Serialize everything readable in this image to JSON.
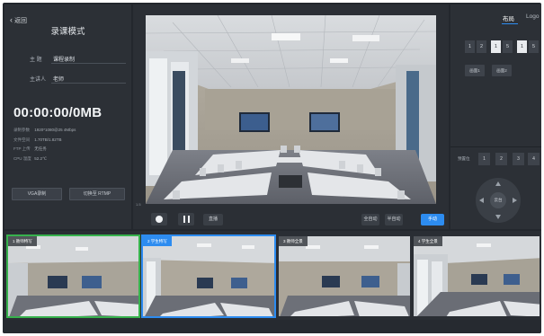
{
  "left": {
    "back": "返回",
    "title": "录课模式",
    "subject_label": "主 题",
    "subject_value": "课程录制",
    "speaker_label": "主讲人",
    "speaker_value": "老师",
    "timer": "00:00:00/0MB",
    "stats": [
      {
        "key": "录制参数",
        "value": "1920*1080@25 4Mbps"
      },
      {
        "key": "文件空间",
        "value": "1.70TB/1.82TB"
      },
      {
        "key": "FTP 上传",
        "value": "无任务"
      },
      {
        "key": "CPU 温度",
        "value": "52.2℃"
      }
    ],
    "vga_button": "VGA录制",
    "rtmp_button": "切换至 RTMP"
  },
  "center": {
    "corner_label": "1.5",
    "live_button": "直播",
    "auto_button": "全自动",
    "semi_button": "半自动",
    "manual_button": "手动"
  },
  "right": {
    "tab_layout": "布局",
    "tab_logo": "Logo",
    "layout_boxes": [
      "1",
      "2",
      "1",
      "5",
      "1",
      "5"
    ],
    "layout_btn_1": "画面1",
    "layout_btn_2": "画面2",
    "preset_label": "预置位",
    "presets": [
      "1",
      "2",
      "3",
      "4"
    ],
    "ptz_center": "云台"
  },
  "cameras": [
    {
      "label": "1 教师特写"
    },
    {
      "label": "2 学生特写"
    },
    {
      "label": "3 教师全景"
    },
    {
      "label": "4 学生全景"
    }
  ],
  "colors": {
    "accent": "#2d8cf0",
    "selected_green": "#37b24d",
    "panel_bg": "#2c3036"
  }
}
